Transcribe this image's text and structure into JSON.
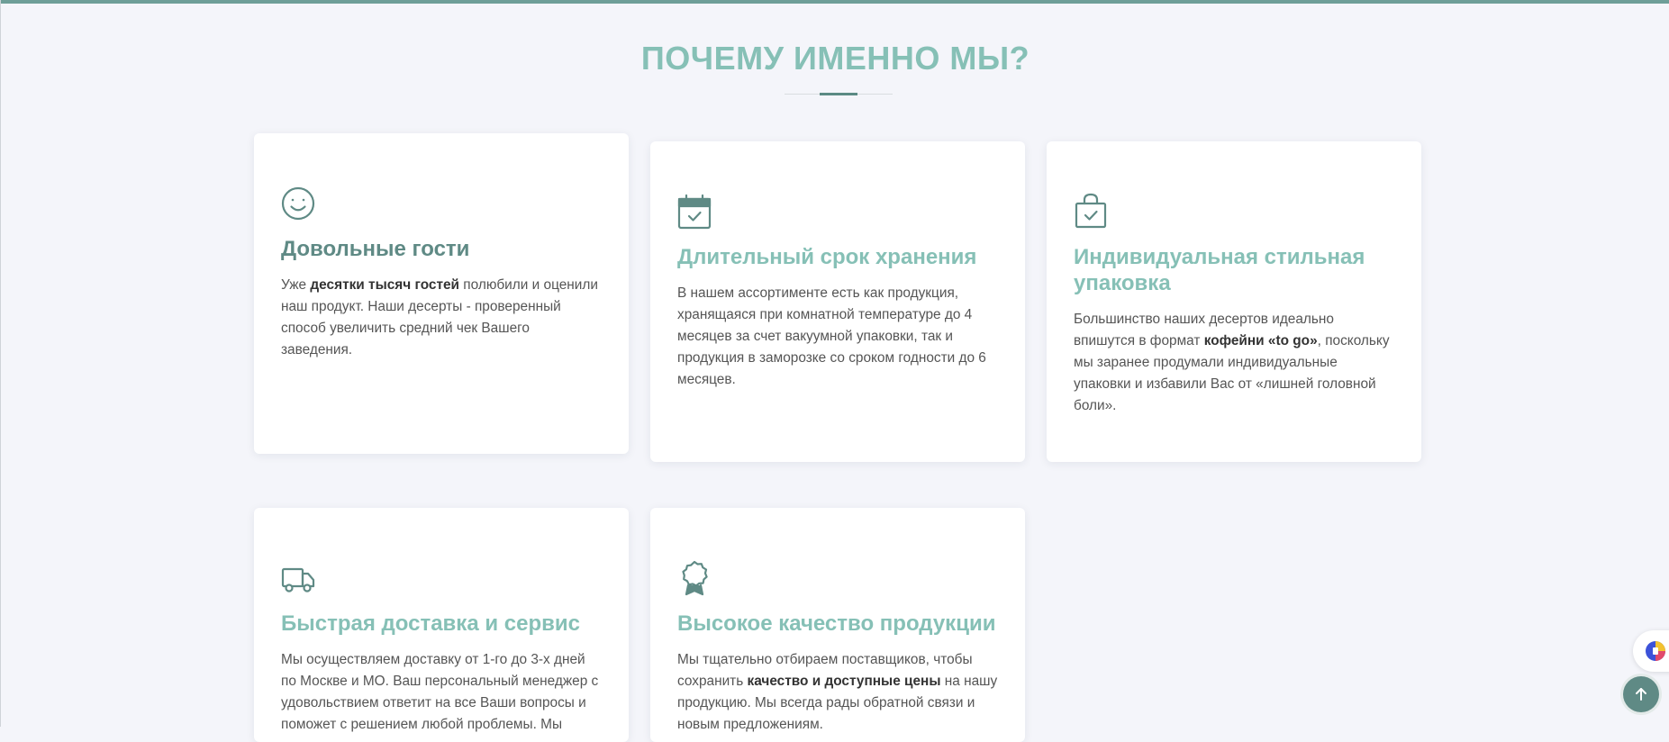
{
  "section": {
    "title": "ПОЧЕМУ ИМЕННО МЫ?"
  },
  "features": [
    {
      "icon": "smiley-icon",
      "title": "Довольные гости",
      "text_parts": [
        "Уже ",
        "десятки тысяч гостей",
        " полюбили и оценили наш продукт. Наши десерты - проверенный способ увеличить средний чек Вашего заведения."
      ]
    },
    {
      "icon": "calendar-check-icon",
      "title": "Длительный срок хранения",
      "text": "В нашем ассортименте есть как продукция, хранящаяся при комнатной температуре до 4 месяцев за счет вакуумной упаковки, так и продукция в заморозке со сроком годности до 6 месяцев."
    },
    {
      "icon": "shopping-bag-check-icon",
      "title": "Индивидуальная стильная упаковка",
      "text_parts": [
        "Большинство наших десертов идеально впишутся в формат ",
        "кофейни «to go»",
        ", поскольку мы заранее продумали индивидуальные упаковки и избавили Вас от «лишней головной боли»."
      ]
    },
    {
      "icon": "delivery-truck-icon",
      "title": "Быстрая доставка и сервис",
      "text": "Мы осуществляем доставку от 1-го до 3-х дней по Москве и МО. Ваш персональный менеджер с удовольствием ответит на все Ваши вопросы и поможет с решением любой проблемы. Мы"
    },
    {
      "icon": "award-badge-icon",
      "title": "Высокое качество продукции",
      "text_parts": [
        "Мы тщательно отбираем поставщиков, чтобы сохранить ",
        "качество и доступные цены",
        " на нашу продукцию. Мы всегда рады обратной связи и новым предложениям."
      ]
    }
  ],
  "colors": {
    "accent": "#86c0b6",
    "accent_dark": "#5f8a85",
    "background": "#f4f5fa"
  },
  "widgets": {
    "scroll_top_icon": "arrow-up-icon",
    "side_widget_icon": "chat-widget-icon"
  }
}
